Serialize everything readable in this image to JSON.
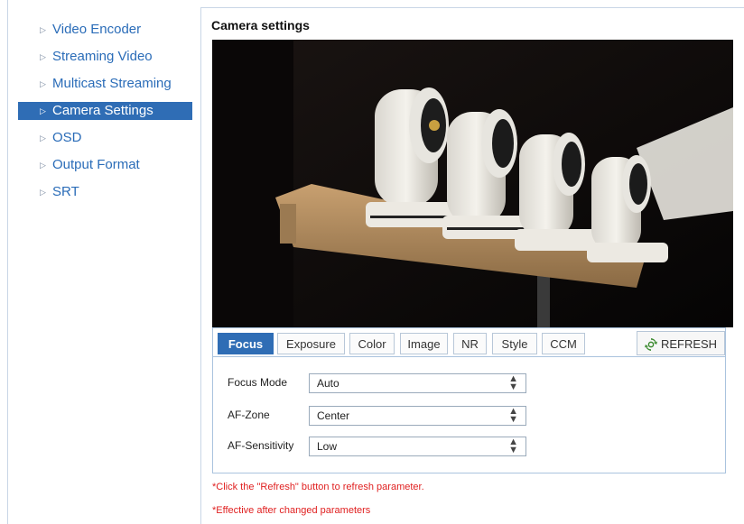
{
  "sidebar": {
    "items": [
      {
        "label": "Video Encoder",
        "active": false
      },
      {
        "label": "Streaming Video",
        "active": false
      },
      {
        "label": "Multicast Streaming",
        "active": false
      },
      {
        "label": "Camera Settings",
        "active": true
      },
      {
        "label": "OSD",
        "active": false
      },
      {
        "label": "Output Format",
        "active": false
      },
      {
        "label": "SRT",
        "active": false
      }
    ]
  },
  "main": {
    "title": "Camera settings",
    "tabs": [
      "Focus",
      "Exposure",
      "Color",
      "Image",
      "NR",
      "Style",
      "CCM"
    ],
    "active_tab": "Focus",
    "refresh_label": "REFRESH",
    "fields": [
      {
        "label": "Focus Mode",
        "value": "Auto"
      },
      {
        "label": "AF-Zone",
        "value": "Center"
      },
      {
        "label": "AF-Sensitivity",
        "value": "Low"
      }
    ],
    "notes": [
      "*Click the \"Refresh\" button to refresh parameter.",
      "*Effective after changed parameters"
    ]
  },
  "colors": {
    "accent": "#2f6db5",
    "link": "#2a6cb8",
    "warning": "#e02020",
    "border": "#aac3de"
  },
  "icons": {
    "nav_marker": "triangle-right-icon",
    "refresh": "refresh-icon",
    "select_arrows": "updown-arrows-icon"
  }
}
